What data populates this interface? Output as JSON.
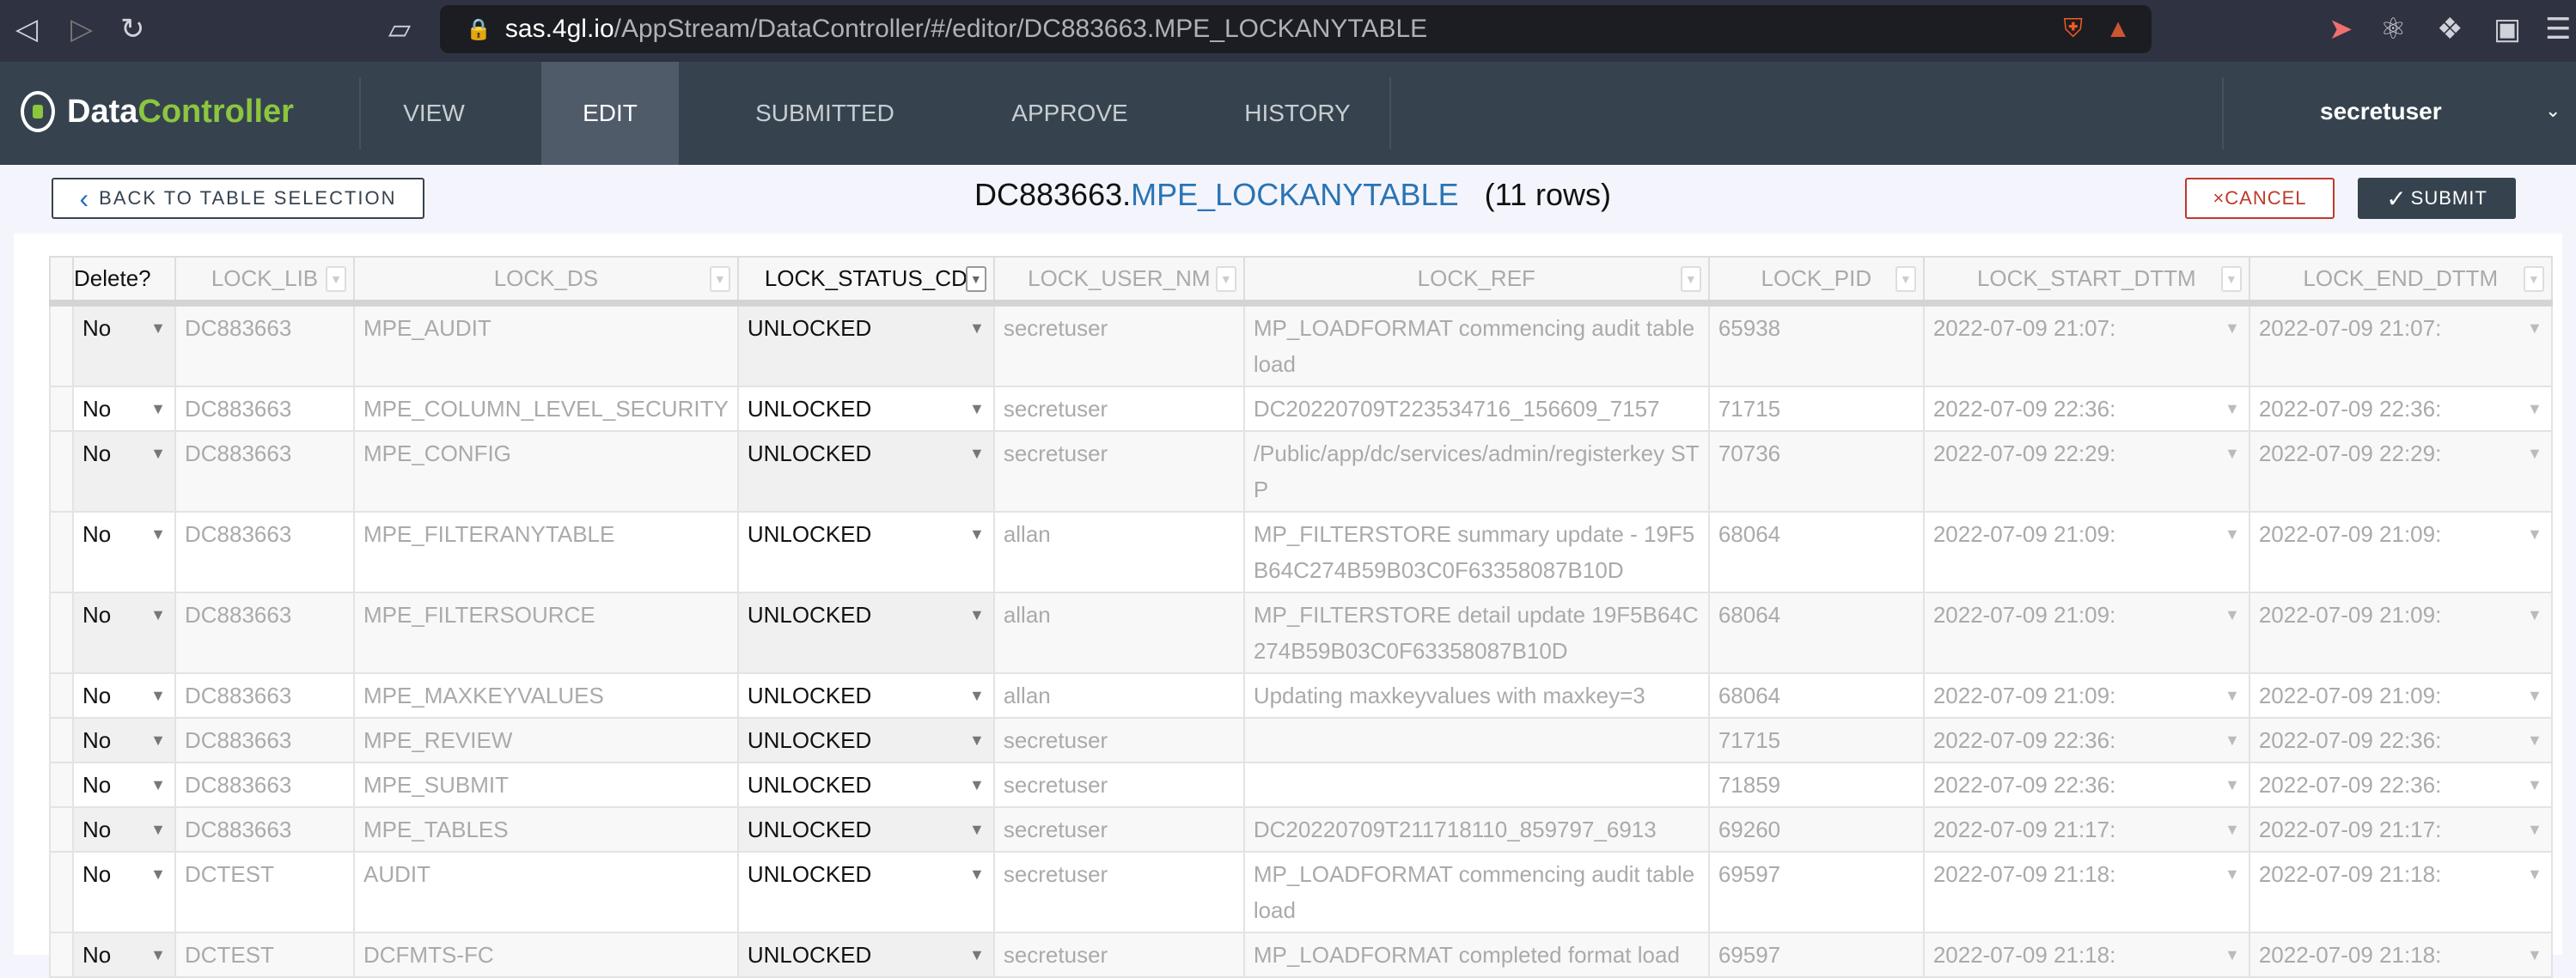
{
  "browser": {
    "url_host": "sas.4gl.io",
    "url_path": "/AppStream/DataController/#/editor/DC883663.MPE_LOCKANYTABLE"
  },
  "app": {
    "logo_a": "Data",
    "logo_b": "Controller",
    "user": "secretuser"
  },
  "nav": {
    "tabs": [
      {
        "label": "VIEW"
      },
      {
        "label": "EDIT",
        "active": true
      },
      {
        "label": "SUBMITTED"
      },
      {
        "label": "APPROVE"
      },
      {
        "label": "HISTORY"
      }
    ]
  },
  "toolbar": {
    "back_label": "BACK TO TABLE SELECTION",
    "lib": "DC883663.",
    "table": "MPE_LOCKANYTABLE",
    "rows": "(11 rows)",
    "cancel_label": "CANCEL",
    "submit_label": "SUBMIT"
  },
  "table": {
    "columns": [
      "Delete?",
      "LOCK_LIB",
      "LOCK_DS",
      "LOCK_STATUS_CD",
      "LOCK_USER_NM",
      "LOCK_REF",
      "LOCK_PID",
      "LOCK_START_DTTM",
      "LOCK_END_DTTM"
    ],
    "rows": [
      [
        "No",
        "DC883663",
        "MPE_AUDIT",
        "UNLOCKED",
        "secretuser",
        "MP_LOADFORMAT commencing audit table load",
        "65938",
        "2022-07-09 21:07:",
        "2022-07-09 21:07:"
      ],
      [
        "No",
        "DC883663",
        "MPE_COLUMN_LEVEL_SECURITY",
        "UNLOCKED",
        "secretuser",
        "DC20220709T223534716_156609_7157",
        "71715",
        "2022-07-09 22:36:",
        "2022-07-09 22:36:"
      ],
      [
        "No",
        "DC883663",
        "MPE_CONFIG",
        "UNLOCKED",
        "secretuser",
        "/Public/app/dc/services/admin/registerkey STP",
        "70736",
        "2022-07-09 22:29:",
        "2022-07-09 22:29:"
      ],
      [
        "No",
        "DC883663",
        "MPE_FILTERANYTABLE",
        "UNLOCKED",
        "allan",
        "MP_FILTERSTORE summary update - 19F5B64C274B59B03C0F63358087B10D",
        "68064",
        "2022-07-09 21:09:",
        "2022-07-09 21:09:"
      ],
      [
        "No",
        "DC883663",
        "MPE_FILTERSOURCE",
        "UNLOCKED",
        "allan",
        "MP_FILTERSTORE detail update 19F5B64C274B59B03C0F63358087B10D",
        "68064",
        "2022-07-09 21:09:",
        "2022-07-09 21:09:"
      ],
      [
        "No",
        "DC883663",
        "MPE_MAXKEYVALUES",
        "UNLOCKED",
        "allan",
        "Updating maxkeyvalues with maxkey=3",
        "68064",
        "2022-07-09 21:09:",
        "2022-07-09 21:09:"
      ],
      [
        "No",
        "DC883663",
        "MPE_REVIEW",
        "UNLOCKED",
        "secretuser",
        "",
        "71715",
        "2022-07-09 22:36:",
        "2022-07-09 22:36:"
      ],
      [
        "No",
        "DC883663",
        "MPE_SUBMIT",
        "UNLOCKED",
        "secretuser",
        "",
        "71859",
        "2022-07-09 22:36:",
        "2022-07-09 22:36:"
      ],
      [
        "No",
        "DC883663",
        "MPE_TABLES",
        "UNLOCKED",
        "secretuser",
        "DC20220709T211718110_859797_6913",
        "69260",
        "2022-07-09 21:17:",
        "2022-07-09 21:17:"
      ],
      [
        "No",
        "DCTEST",
        "AUDIT",
        "UNLOCKED",
        "secretuser",
        "MP_LOADFORMAT commencing audit table load",
        "69597",
        "2022-07-09 21:18:",
        "2022-07-09 21:18:"
      ],
      [
        "No",
        "DCTEST",
        "DCFMTS-FC",
        "UNLOCKED",
        "secretuser",
        "MP_LOADFORMAT completed format load",
        "69597",
        "2022-07-09 21:18:",
        "2022-07-09 21:18:"
      ]
    ]
  }
}
